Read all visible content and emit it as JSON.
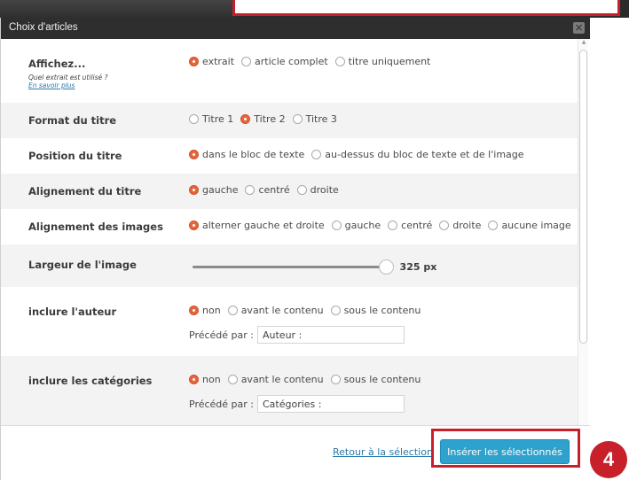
{
  "dialog": {
    "title": "Choix d'articles",
    "close_icon": "close-icon"
  },
  "rows": {
    "affichez": {
      "label": "Affichez...",
      "sub": "Quel extrait est utilisé ?",
      "link": "En savoir plus",
      "options": [
        "extrait",
        "article complet",
        "titre uniquement"
      ],
      "selected": "extrait"
    },
    "format_titre": {
      "label": "Format du titre",
      "options": [
        "Titre 1",
        "Titre 2",
        "Titre 3"
      ],
      "selected": "Titre 2"
    },
    "position_titre": {
      "label": "Position du titre",
      "options": [
        "dans le bloc de texte",
        "au-dessus du bloc de texte et de l'image"
      ],
      "selected": "dans le bloc de texte"
    },
    "alignement_titre": {
      "label": "Alignement du titre",
      "options": [
        "gauche",
        "centré",
        "droite"
      ],
      "selected": "gauche"
    },
    "alignement_images": {
      "label": "Alignement des images",
      "options": [
        "alterner gauche et droite",
        "gauche",
        "centré",
        "droite",
        "aucune image"
      ],
      "selected": "alterner gauche et droite"
    },
    "largeur_image": {
      "label": "Largeur de l'image",
      "value": "325 px",
      "fraction": 0.98
    },
    "inclure_auteur": {
      "label": "inclure l'auteur",
      "options": [
        "non",
        "avant le contenu",
        "sous le contenu"
      ],
      "selected": "non",
      "prefix_label": "Précédé par :",
      "prefix_value": "Auteur :"
    },
    "inclure_categories": {
      "label": "inclure les catégories",
      "options": [
        "non",
        "avant le contenu",
        "sous le contenu"
      ],
      "selected": "non",
      "prefix_label": "Précédé par :",
      "prefix_value": "Catégories :"
    }
  },
  "footer": {
    "back_link": "Retour à la sélection",
    "insert_button": "Insérer les sélectionnés"
  },
  "callout": {
    "step": "4",
    "color": "#c7202a"
  },
  "colors": {
    "accent_radio": "#e8643a",
    "primary_button": "#2ea2cc",
    "titlebar": "#2e2e2e",
    "link": "#2a7aa8"
  }
}
